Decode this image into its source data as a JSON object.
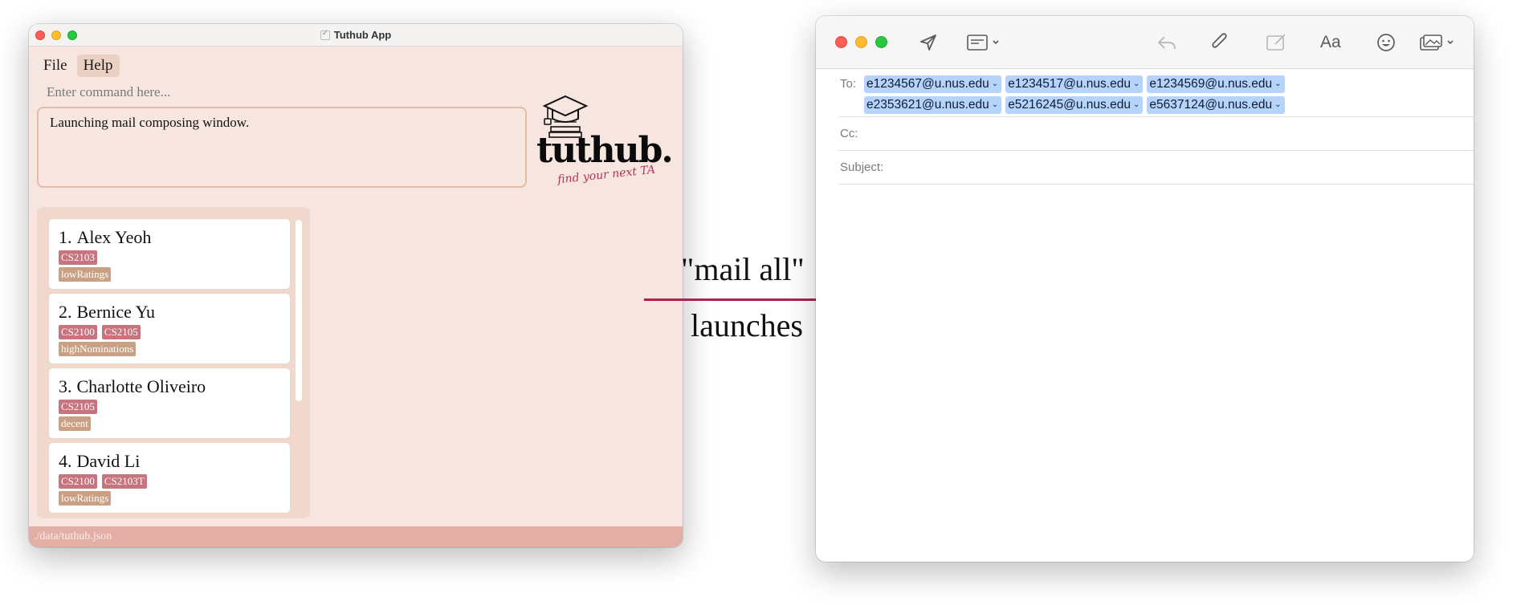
{
  "tuthub": {
    "title": "Tuthub App",
    "menu": [
      "File",
      "Help"
    ],
    "command_placeholder": "Enter command here...",
    "result_text": "Launching mail composing window.",
    "logo_word": "tuthub.",
    "logo_tagline": "find your next TA",
    "list": [
      {
        "index": "1.",
        "name": "Alex Yeoh",
        "modules": [
          "CS2103"
        ],
        "rating": "lowRatings"
      },
      {
        "index": "2.",
        "name": "Bernice Yu",
        "modules": [
          "CS2100",
          "CS2105"
        ],
        "rating": "highNominations"
      },
      {
        "index": "3.",
        "name": "Charlotte Oliveiro",
        "modules": [
          "CS2105"
        ],
        "rating": "decent"
      },
      {
        "index": "4.",
        "name": "David Li",
        "modules": [
          "CS2100",
          "CS2103T"
        ],
        "rating": "lowRatings"
      }
    ],
    "status_path": "./data/tuthub.json"
  },
  "annotation": {
    "command": "\"mail all\"",
    "verb": "launches",
    "arrow_color": "#b21f4f"
  },
  "mail": {
    "to_label": "To:",
    "cc_label": "Cc:",
    "subject_label": "Subject:",
    "recipients": [
      "e1234567@u.nus.edu",
      "e1234517@u.nus.edu",
      "e1234569@u.nus.edu",
      "e2353621@u.nus.edu",
      "e5216245@u.nus.edu",
      "e5637124@u.nus.edu"
    ],
    "toolbar_icons": [
      "send-icon",
      "header-fields-icon",
      "reply-icon",
      "attachment-icon",
      "markup-icon",
      "format-icon",
      "emoji-icon",
      "photo-browser-icon"
    ],
    "format_label": "Aa"
  },
  "colors": {
    "tuthub_bg": "#f6e6df",
    "module_tag": "#c7747f",
    "rating_tag": "#c9a083",
    "status_bar": "#e2aea6",
    "recipient_chip": "#b6d4fb"
  }
}
